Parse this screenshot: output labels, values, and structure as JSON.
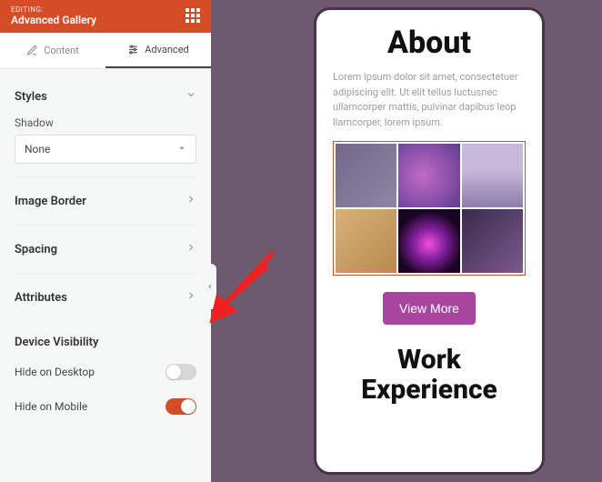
{
  "header": {
    "editing_label": "EDITING:",
    "title": "Advanced Gallery"
  },
  "tabs": {
    "content": "Content",
    "advanced": "Advanced"
  },
  "styles": {
    "label": "Styles",
    "shadow_label": "Shadow",
    "shadow_value": "None"
  },
  "rows": {
    "image_border": "Image Border",
    "spacing": "Spacing",
    "attributes": "Attributes",
    "device_visibility": "Device Visibility"
  },
  "toggles": {
    "hide_desktop_label": "Hide on Desktop",
    "hide_desktop_on": false,
    "hide_mobile_label": "Hide on Mobile",
    "hide_mobile_on": true
  },
  "preview": {
    "about_title": "About",
    "lorem": "Lorem ipsum dolor sit amet, consectetuer adipiscing elit. Ut elit tellus luctusnec ullamcorper mattis, pulvinar dapibus leop llamcorper, lorem ipsum.",
    "view_more": "View More",
    "work_title": "Work Experience"
  }
}
